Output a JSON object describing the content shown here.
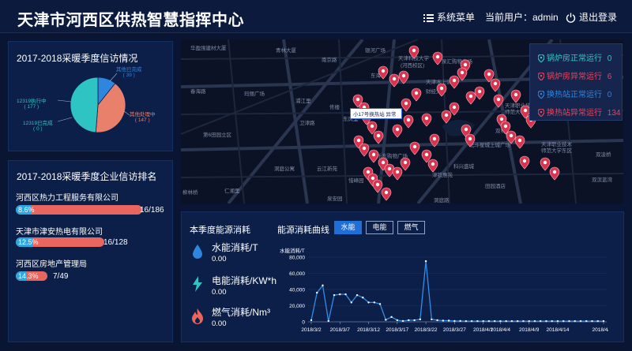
{
  "header": {
    "title": "天津市河西区供热智慧指挥中心",
    "menu_label": "系统菜单",
    "user_label": "当前用户：admin",
    "logout_label": "退出登录"
  },
  "petition": {
    "title": "2017-2018采暖季度信访情况",
    "slices": [
      {
        "label": "其他已完成",
        "value": 39,
        "value_text": "( 39 )",
        "color": "#2e86de"
      },
      {
        "label": "其他处理中",
        "value": 147,
        "value_text": "( 147 )",
        "color": "#e8806b"
      },
      {
        "label": "12319已完成",
        "value": 0,
        "value_text": "( 0 )",
        "color": "#2fb6c4"
      },
      {
        "label": "12319执行中",
        "value": 177,
        "value_text": "( 177 )",
        "color": "#2ec4c4"
      }
    ]
  },
  "ranking": {
    "title": "2017-2018采暖季度企业信访排名",
    "items": [
      {
        "name": "河西区热力工程服务有限公司",
        "pct": "8.6%",
        "fraction": 0.086,
        "count": "16/186"
      },
      {
        "name": "天津市津安热电有限公司",
        "pct": "12.5%",
        "fraction": 0.125,
        "count": "16/128"
      },
      {
        "name": "河西区房地产管理局",
        "pct": "14.3%",
        "fraction": 0.143,
        "count": "7/49"
      }
    ]
  },
  "map": {
    "labels": [
      "华盈围建材大厦",
      "青林大厦",
      "银河广场",
      "南京路",
      "春海路",
      "玛丽广场",
      "浦江里",
      "佟楼",
      "东海",
      "天津科技大学",
      "(河西校区)",
      "泉汇购物广场",
      "天津水上公园",
      "财经大学",
      "天津职业技术",
      "师范大学",
      "卫津路",
      "东风里",
      "双林",
      "北斗星城上城广场",
      "天津职业技术",
      "师范大学东区",
      "双凌桥",
      "第6田园立区",
      "乐东购物广场",
      "云江新苑",
      "洞庭公寓",
      "津铁惠苑",
      "科兴盛城",
      "仁湘里",
      "惜峰园",
      "田园酒店",
      "双滨蓝湾",
      "柳林桥",
      "泉安园",
      "洞庭路"
    ],
    "popup": "小17号换热站 异常",
    "legend": [
      {
        "label": "锅炉房正常运行",
        "count": "0",
        "color": "#36c6c6"
      },
      {
        "label": "锅炉房异常运行",
        "count": "6",
        "color": "#e8465e"
      },
      {
        "label": "换热站正常运行",
        "count": "0",
        "color": "#2e86de"
      },
      {
        "label": "换热站异常运行",
        "count": "134",
        "color": "#e8465e"
      }
    ]
  },
  "energy": {
    "title": "本季度能源消耗",
    "items": [
      {
        "label": "水能消耗/T",
        "value": "0.00",
        "icon": "water-drop-icon"
      },
      {
        "label": "电能消耗/KW*h",
        "value": "0.00",
        "icon": "lightning-icon"
      },
      {
        "label": "燃气消耗/Nm³",
        "value": "0.00",
        "icon": "flame-icon"
      }
    ]
  },
  "curve": {
    "title": "能源消耗曲线",
    "tabs": [
      {
        "label": "水能",
        "active": true
      },
      {
        "label": "电能",
        "active": false
      },
      {
        "label": "燃气",
        "active": false
      }
    ]
  },
  "chart_data": {
    "type": "line",
    "ylabel": "水能消耗/T",
    "ylim": [
      0,
      80000
    ],
    "yticks": [
      0,
      20000,
      40000,
      60000,
      80000
    ],
    "ytick_labels": [
      "0",
      "20,000",
      "40,000",
      "60,000",
      "80,000"
    ],
    "xtick_labels": [
      "2018/3/2",
      "2018/3/7",
      "2018/3/12",
      "2018/3/17",
      "2018/3/22",
      "2018/3/27",
      "2018/4/1",
      "2018/4/4",
      "2018/4/9",
      "2018/4/14",
      "2018/4/22"
    ],
    "series": [
      {
        "color": "#2e8ee8",
        "x": [
          "2018/3/2",
          "2018/3/3",
          "2018/3/4",
          "2018/3/5",
          "2018/3/6",
          "2018/3/7",
          "2018/3/8",
          "2018/3/9",
          "2018/3/10",
          "2018/3/11",
          "2018/3/12",
          "2018/3/13",
          "2018/3/14",
          "2018/3/15",
          "2018/3/16",
          "2018/3/17",
          "2018/3/18",
          "2018/3/19",
          "2018/3/20",
          "2018/3/21",
          "2018/3/22",
          "2018/3/23",
          "2018/3/24",
          "2018/3/25",
          "2018/3/26",
          "2018/3/27",
          "2018/3/28",
          "2018/3/29",
          "2018/3/30",
          "2018/3/31",
          "2018/4/1",
          "2018/4/2",
          "2018/4/3",
          "2018/4/4",
          "2018/4/5",
          "2018/4/6",
          "2018/4/7",
          "2018/4/8",
          "2018/4/9",
          "2018/4/10",
          "2018/4/11",
          "2018/4/12",
          "2018/4/13",
          "2018/4/14",
          "2018/4/15",
          "2018/4/16",
          "2018/4/17",
          "2018/4/18",
          "2018/4/19",
          "2018/4/20",
          "2018/4/21",
          "2018/4/22"
        ],
        "values": [
          2000,
          36000,
          45000,
          1000,
          33000,
          34000,
          34000,
          24000,
          33000,
          30000,
          24000,
          24000,
          22000,
          2500,
          6000,
          2000,
          1000,
          2000,
          2000,
          3000,
          75000,
          3000,
          2000,
          1500,
          1500,
          1000,
          1000,
          800,
          800,
          800,
          800,
          800,
          800,
          800,
          800,
          800,
          800,
          800,
          800,
          800,
          800,
          800,
          800,
          800,
          800,
          800,
          800,
          800,
          800,
          800,
          800,
          800
        ]
      }
    ]
  }
}
